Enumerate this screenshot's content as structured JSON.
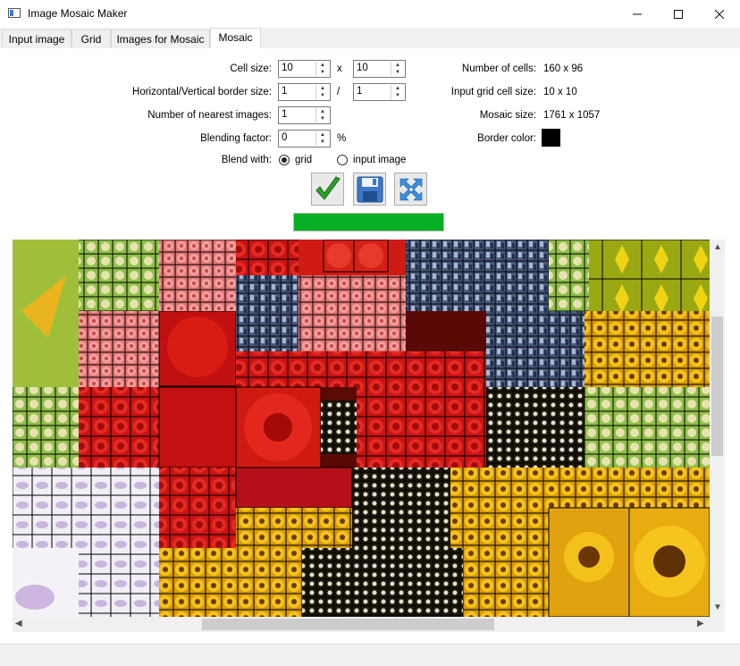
{
  "window": {
    "title": "Image Mosaic Maker",
    "minimize_icon": "minimize-icon",
    "maximize_icon": "maximize-icon",
    "close_icon": "close-icon"
  },
  "tabs": [
    {
      "label": "Input image"
    },
    {
      "label": "Grid"
    },
    {
      "label": "Images for Mosaic"
    },
    {
      "label": "Mosaic",
      "active": true
    }
  ],
  "form": {
    "cell_size_label": "Cell size:",
    "cell_w": "10",
    "cell_x_sep": "x",
    "cell_h": "10",
    "border_label": "Horizontal/Vertical border size:",
    "border_h": "1",
    "border_sep": "/",
    "border_v": "1",
    "nearest_label": "Number of nearest images:",
    "nearest": "1",
    "blending_label": "Blending factor:",
    "blending": "0",
    "blending_unit": "%",
    "blend_with_label": "Blend with:",
    "blend_options": [
      {
        "label": "grid",
        "selected": true
      },
      {
        "label": "input image",
        "selected": false
      }
    ]
  },
  "info": {
    "cells_label": "Number of cells:",
    "cells_value": "160 x 96",
    "grid_cell_label": "Input grid cell size:",
    "grid_cell_value": "10 x 10",
    "mosaic_label": "Mosaic size:",
    "mosaic_value": "1761 x 1057",
    "border_color_label": "Border color:",
    "border_color": "#000000"
  },
  "actions": [
    {
      "name": "apply",
      "icon": "checkmark-icon"
    },
    {
      "name": "save",
      "icon": "floppy-disk-icon"
    },
    {
      "name": "fit",
      "icon": "expand-arrows-icon"
    }
  ],
  "progress": {
    "value": 1.0,
    "color": "#06b025"
  },
  "colors": {
    "accent_blue": "#3a7bd5",
    "tab_bg": "#f0f0f0"
  }
}
